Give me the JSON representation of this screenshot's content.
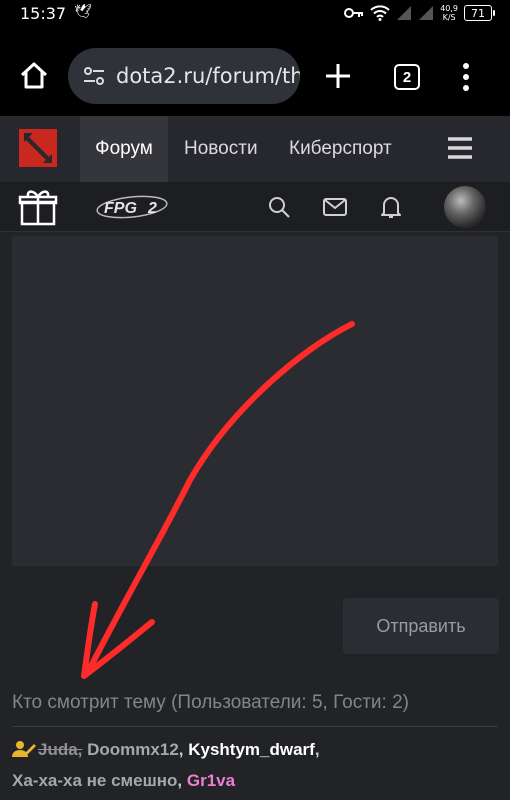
{
  "status_bar": {
    "time": "15:37",
    "net_speed_value": "40,9",
    "net_speed_unit": "K/S",
    "battery": "71"
  },
  "browser": {
    "url": "dota2.ru/forum/th",
    "tab_count": "2"
  },
  "site_nav": {
    "items": [
      {
        "label": "Форум",
        "active": true
      },
      {
        "label": "Новости",
        "active": false
      },
      {
        "label": "Киберспорт",
        "active": false
      }
    ],
    "fpg_logo_text": "FPG"
  },
  "reply": {
    "send_label": "Отправить"
  },
  "viewers": {
    "title": "Кто смотрит тему (Пользователи: 5, Гости: 2)",
    "users": [
      {
        "name": "Juda,",
        "style": "struck",
        "icon": "moderator-icon"
      },
      {
        "name": "Doommx12",
        "style": "gray"
      },
      {
        "name": "Kyshtym_dwarf",
        "style": "white"
      },
      {
        "name": "Ха-ха-ха не смешно",
        "style": "gray"
      },
      {
        "name": "Gr1va",
        "style": "pink"
      }
    ]
  },
  "colors": {
    "accent_red": "#ff2a2a",
    "logo_red": "#c8281e",
    "pink_user": "#ec7fd0"
  }
}
